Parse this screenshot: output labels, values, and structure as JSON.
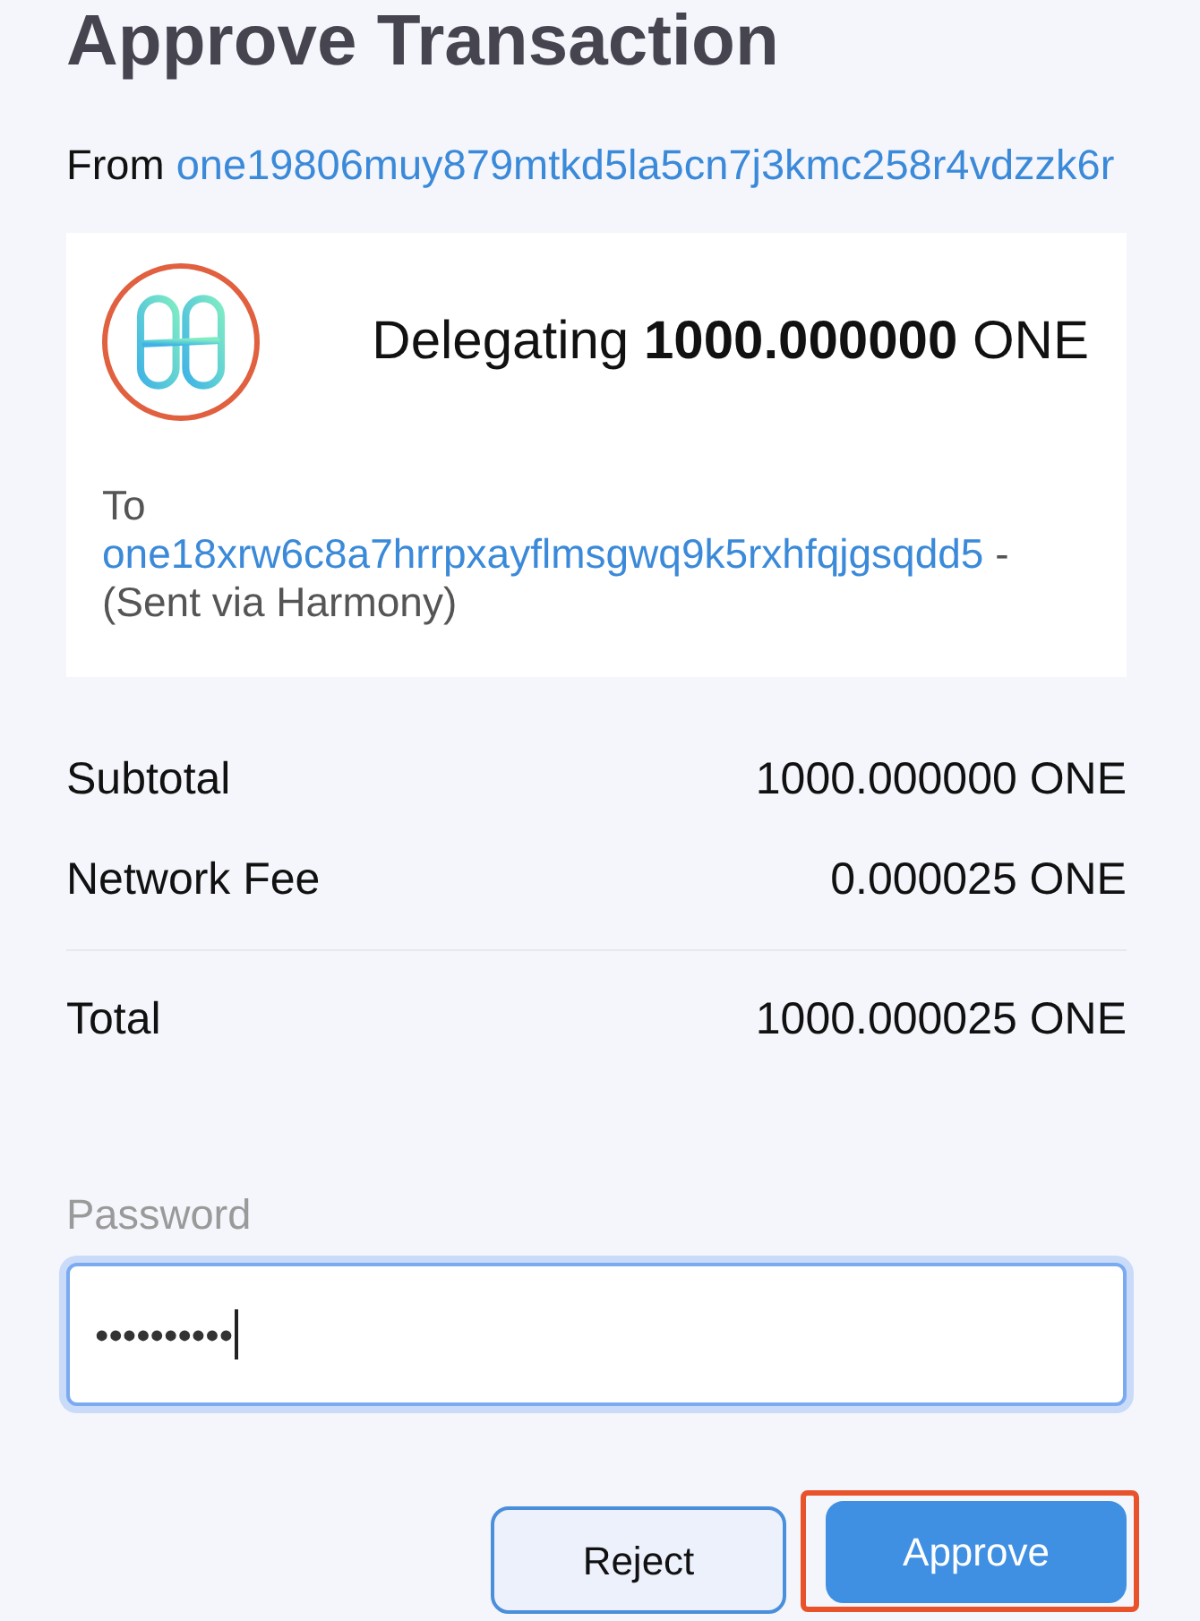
{
  "title": "Approve Transaction",
  "from": {
    "label": "From",
    "address": "one19806muy879mtkd5la5cn7j3kmc258r4vdzzk6r"
  },
  "summary_card": {
    "logo": {
      "highlighted": true
    },
    "headline": "Delegating **1000.000000** ONE",
    "to_label": "To",
    "to_address": "one18xrw6c8a7hrrpxayflmsgwq9k5rxhfqjgsqdd5",
    "to_note": "- (Sent via Harmony)"
  },
  "amounts": [
    {
      "label": "Subtotal",
      "value": "1000.000000 ONE",
      "divider_above": false
    },
    {
      "label": "Network Fee",
      "value": "0.000025 ONE",
      "divider_above": false
    },
    {
      "label": "Total",
      "value": "1000.000025 ONE",
      "divider_above": true
    }
  ],
  "password": {
    "label": "Password",
    "value": "••••••••••",
    "focused": true
  },
  "buttons": [
    {
      "label": "Reject",
      "kind": "secondary",
      "highlighted": false
    },
    {
      "label": "Approve",
      "kind": "primary",
      "highlighted": true
    }
  ]
}
